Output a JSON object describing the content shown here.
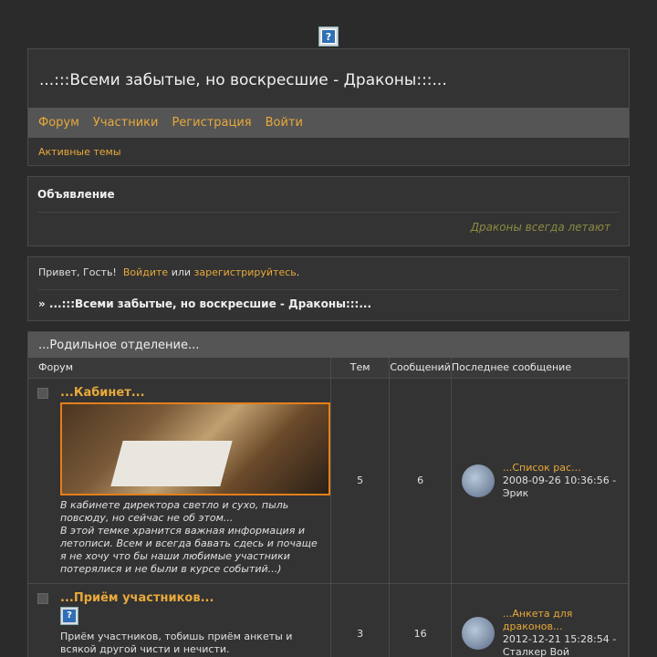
{
  "site_title": "...:::Всеми забытые, но воскресшие - Драконы:::...",
  "nav": [
    "Форум",
    "Участники",
    "Регистрация",
    "Войти"
  ],
  "sub_nav": "Активные темы",
  "announcement": {
    "title": "Объявление",
    "text": "Драконы всегда летают"
  },
  "welcome": {
    "greeting": "Привет, Гость!",
    "login": "Войдите",
    "or": "или",
    "register": "зарегистрируйтесь",
    "dot": "."
  },
  "breadcrumb": "» ...:::Всеми забытые, но воскресшие - Драконы:::...",
  "category": {
    "title": "...Родильное отделение...",
    "headers": {
      "forum": "Форум",
      "topics": "Тем",
      "posts": "Сообщений",
      "last": "Последнее сообщение"
    },
    "forums": [
      {
        "name": "...Кабинет...",
        "description": "В кабинете директора светло и сухо, пыль повсюду, но сейчас не об этом...\nВ этой темке хранится важная информация и летописи. Всем и всегда бавать сдесь и почаще я не хочу что бы наши любимые участники потерялися и не были в курсе событий...)",
        "topics": "5",
        "posts": "6",
        "last_title": "...Список рас...",
        "last_meta": "2008-09-26 10:36:56 - Эрик"
      },
      {
        "name": "...Приём участников...",
        "description": "Приём участников, тобишь приём анкеты и всякой другой чисти и нечисти.\nПомним, что до принятия анкеты мастером",
        "topics": "3",
        "posts": "16",
        "last_title": "...Анкета для драконов...",
        "last_meta": "2012-12-21 15:28:54 - Сталкер Вой"
      }
    ]
  },
  "icons": {
    "placeholder": "?"
  }
}
